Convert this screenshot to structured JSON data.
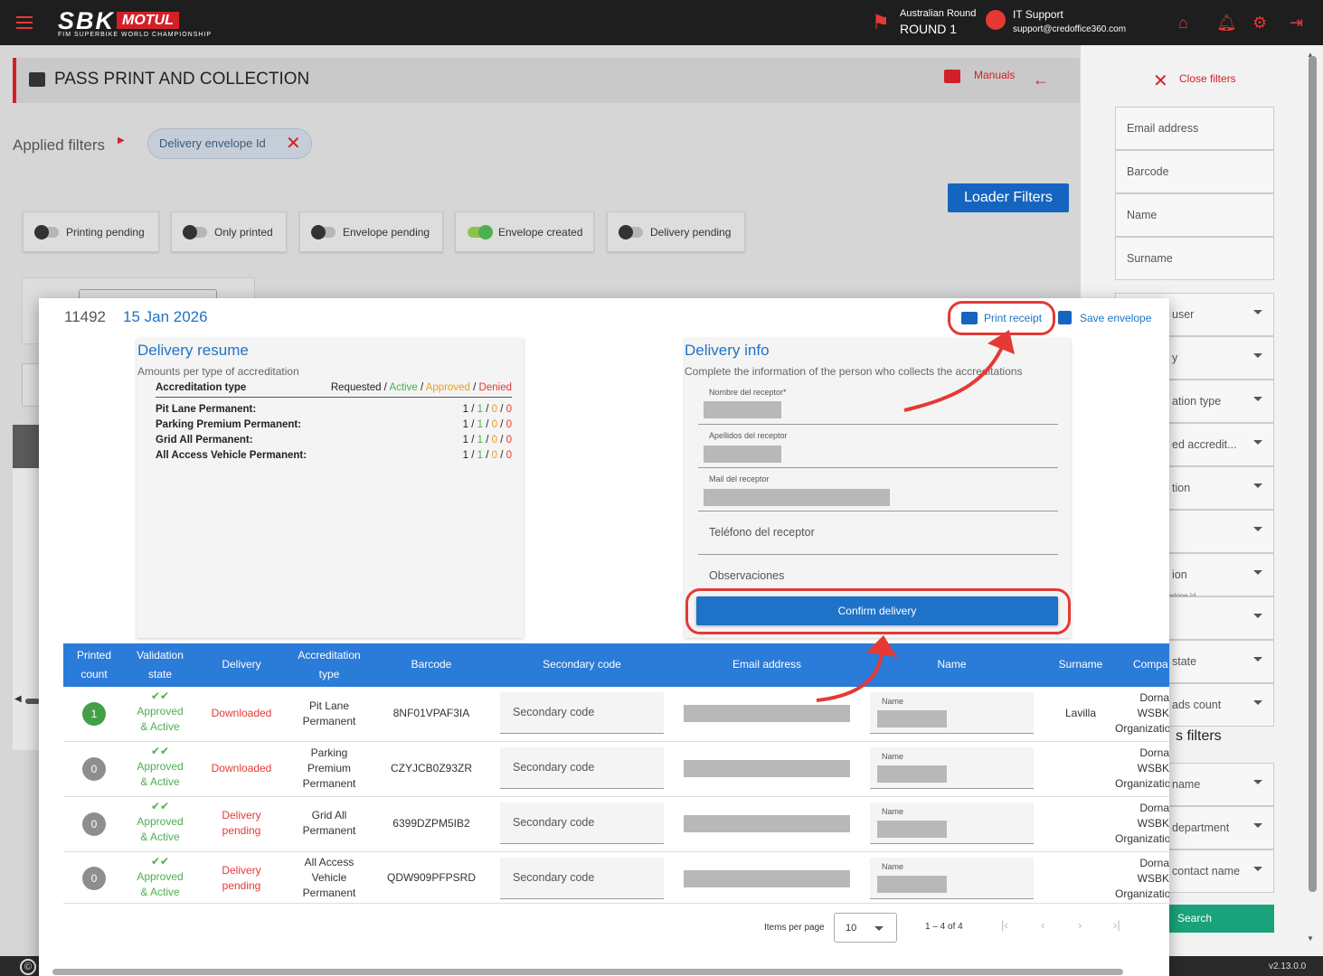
{
  "header": {
    "logo_text": "SBK",
    "logo_brand": "MOTUL",
    "logo_sub": "FIM SUPERBIKE WORLD CHAMPIONSHIP",
    "round_event": "Australian Round",
    "round_label": "ROUND 1",
    "user_name": "IT Support",
    "user_email": "support@credoffice360.com",
    "icons": [
      "menu-icon",
      "flag-icon",
      "account-icon",
      "home-icon",
      "bell-icon",
      "gear-icon",
      "logout-icon"
    ]
  },
  "page": {
    "title": "PASS PRINT AND COLLECTION",
    "manuals": "Manuals",
    "applied_filters_label": "Applied filters",
    "chip_label": "Delivery envelope Id",
    "loader_filters": "Loader Filters",
    "toggles": [
      {
        "label": "Printing pending",
        "on": false
      },
      {
        "label": "Only printed",
        "on": false
      },
      {
        "label": "Envelope pending",
        "on": false
      },
      {
        "label": "Envelope created",
        "on": true
      },
      {
        "label": "Delivery pending",
        "on": false
      }
    ]
  },
  "filters": {
    "close_label": "Close filters",
    "fields": [
      "Email address",
      "Barcode",
      "Name",
      "Surname"
    ],
    "dropdowns": [
      "user",
      "y",
      "ation type",
      "ed accredit...",
      "tion",
      "",
      "ion",
      "",
      "state",
      "ads count"
    ],
    "dropdown_note": "velope Id",
    "more_filters_title": "s filters",
    "more_dropdowns": [
      "name",
      "department",
      "contact name"
    ],
    "search": "Search"
  },
  "modal": {
    "id": "11492",
    "date": "15 Jan 2026",
    "print_receipt": "Print receipt",
    "save_envelope": "Save envelope",
    "resume": {
      "title": "Delivery resume",
      "subtitle": "Amounts per type of accreditation",
      "col_type": "Accreditation type",
      "col_requested": "Requested",
      "col_active": "Active",
      "col_approved": "Approved",
      "col_denied": "Denied",
      "rows": [
        {
          "type": "Pit Lane Permanent:",
          "req": "1",
          "act": "1",
          "app": "0",
          "den": "0"
        },
        {
          "type": "Parking Premium Permanent:",
          "req": "1",
          "act": "1",
          "app": "0",
          "den": "0"
        },
        {
          "type": "Grid All Permanent:",
          "req": "1",
          "act": "1",
          "app": "0",
          "den": "0"
        },
        {
          "type": "All Access Vehicle Permanent:",
          "req": "1",
          "act": "1",
          "app": "0",
          "den": "0"
        }
      ]
    },
    "info": {
      "title": "Delivery info",
      "subtitle": "Complete the information of the person who collects the accreditations",
      "f_nombre": "Nombre del receptor*",
      "f_apellidos": "Apellidos del receptor",
      "f_mail": "Mail del receptor",
      "f_telefono": "Teléfono del receptor",
      "f_obs": "Observaciones",
      "confirm": "Confirm delivery"
    },
    "table": {
      "headers": {
        "printed": "Printed count",
        "validation": "Validation state",
        "delivery": "Delivery",
        "type": "Accreditation type",
        "barcode": "Barcode",
        "secondary": "Secondary code",
        "email": "Email address",
        "name": "Name",
        "surname": "Surname",
        "company": "Compa"
      },
      "secondary_placeholder": "Secondary code",
      "name_label": "Name",
      "rows": [
        {
          "count": "1",
          "count_color": "#43a047",
          "validation": "Approved & Active",
          "delivery": "Downloaded",
          "type": "Pit Lane Permanent",
          "barcode": "8NF01VPAF3IA",
          "surname": "Lavilla",
          "company": "Dorna WSBK Organization"
        },
        {
          "count": "0",
          "count_color": "#8e8e8e",
          "validation": "Approved & Active",
          "delivery": "Downloaded",
          "type": "Parking Premium Permanent",
          "barcode": "CZYJCB0Z93ZR",
          "surname": "",
          "company": "Dorna WSBK Organization"
        },
        {
          "count": "0",
          "count_color": "#8e8e8e",
          "validation": "Approved & Active",
          "delivery": "Delivery pending",
          "type": "Grid All Permanent",
          "barcode": "6399DZPM5IB2",
          "surname": "",
          "company": "Dorna WSBK Organization"
        },
        {
          "count": "0",
          "count_color": "#8e8e8e",
          "validation": "Approved & Active",
          "delivery": "Delivery pending",
          "type": "All Access Vehicle Permanent",
          "barcode": "QDW909PFPSRD",
          "surname": "",
          "company": "Dorna WSBK Organization"
        }
      ]
    },
    "pagination": {
      "items_per_page_label": "Items per page",
      "page_size": "10",
      "range": "1 – 4 of 4"
    }
  },
  "footer": {
    "version": "v2.13.0.0",
    "copyright": "©"
  },
  "colors": {
    "accent_red": "#e53935",
    "primary_blue": "#1e73c8",
    "header_blue": "#2b7bd8",
    "success_green": "#4caf50"
  }
}
